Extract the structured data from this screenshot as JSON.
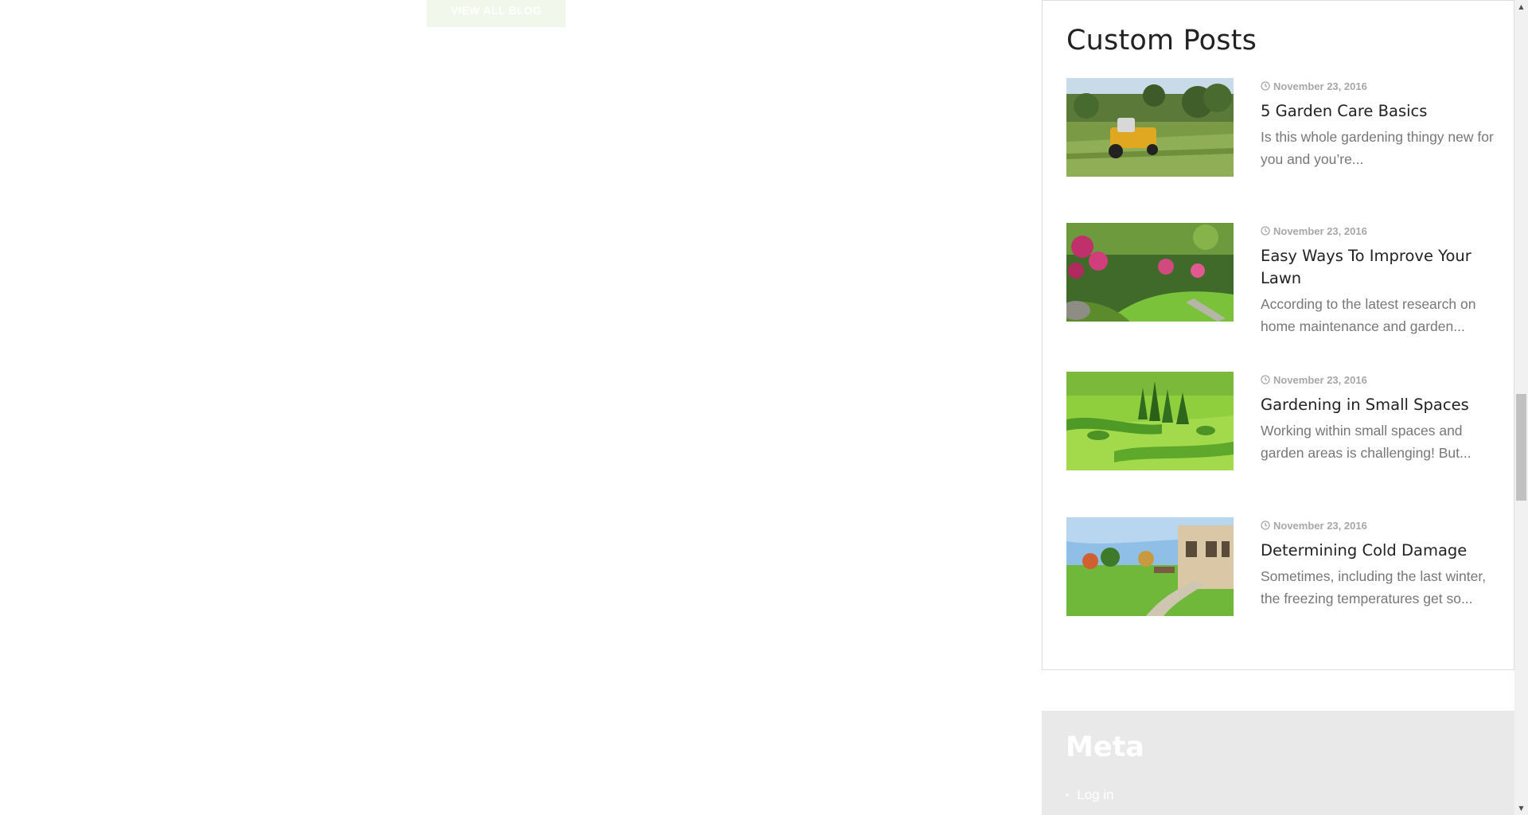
{
  "view_all_button": {
    "label": "VIEW ALL BLOG"
  },
  "custom_posts": {
    "title": "Custom Posts",
    "posts": [
      {
        "date": "November 23, 2016",
        "title": "5 Garden Care Basics",
        "excerpt": "Is this whole gardening thingy new for you and you’re...",
        "thumb": "lawn-mower"
      },
      {
        "date": "November 23, 2016",
        "title": "Easy Ways To Improve Your Lawn",
        "excerpt": "According to the latest research on home maintenance and garden...",
        "thumb": "flower-garden"
      },
      {
        "date": "November 23, 2016",
        "title": "Gardening in Small Spaces",
        "excerpt": "Working within small spaces and garden areas is challenging! But...",
        "thumb": "topiary-garden"
      },
      {
        "date": "November 23, 2016",
        "title": "Determining Cold Damage",
        "excerpt": "Sometimes, including the last winter, the freezing temperatures get so...",
        "thumb": "backyard-patio"
      }
    ]
  },
  "meta": {
    "title": "Meta",
    "links": [
      "Log in"
    ]
  },
  "colors": {
    "date_gray": "#a7a7a7",
    "excerpt_gray": "#777777",
    "meta_bg": "#e9e9e9",
    "button_bg": "#f1f7ea"
  }
}
